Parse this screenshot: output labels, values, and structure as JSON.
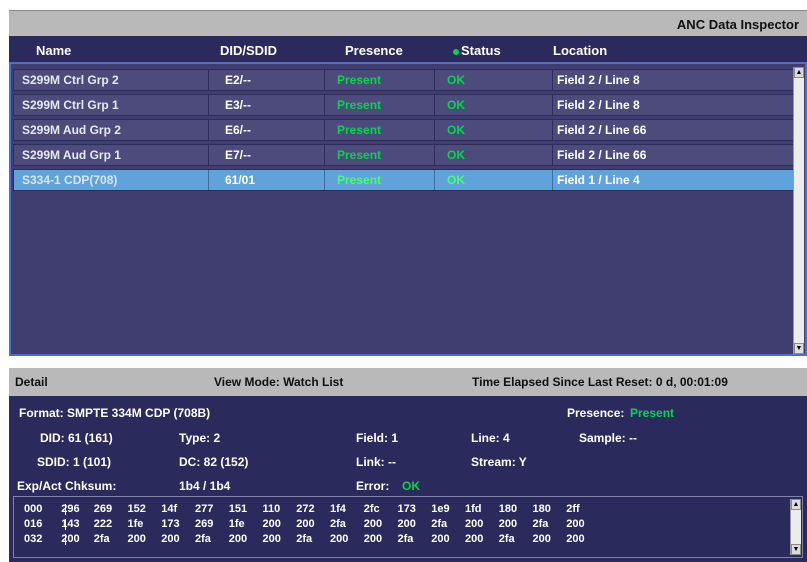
{
  "window": {
    "title": "ANC Data Inspector"
  },
  "columns": {
    "name": "Name",
    "did": "DID/SDID",
    "presence": "Presence",
    "status": "Status",
    "location": "Location"
  },
  "rows": [
    {
      "name": "S299M Ctrl Grp 2",
      "did": "E2/--",
      "presence": "Present",
      "status": "OK",
      "location": "Field 2 / Line 8",
      "selected": false
    },
    {
      "name": "S299M Ctrl Grp 1",
      "did": "E3/--",
      "presence": "Present",
      "status": "OK",
      "location": "Field 2 / Line 8",
      "selected": false
    },
    {
      "name": "S299M Aud Grp 2",
      "did": "E6/--",
      "presence": "Present",
      "status": "OK",
      "location": "Field 2 / Line 66",
      "selected": false
    },
    {
      "name": "S299M Aud Grp 1",
      "did": "E7/--",
      "presence": "Present",
      "status": "OK",
      "location": "Field 2 / Line 66",
      "selected": false
    },
    {
      "name": "S334-1 CDP(708)",
      "did": "61/01",
      "presence": "Present",
      "status": "OK",
      "location": "Field 1 / Line 4",
      "selected": true
    }
  ],
  "detail_header": {
    "title": "Detail",
    "view_mode": "View Mode: Watch List",
    "elapsed": "Time Elapsed Since Last Reset: 0 d, 00:01:09"
  },
  "detail": {
    "format": "Format:  SMPTE 334M CDP (708B)",
    "presence_label": "Presence:",
    "presence_value": "Present",
    "did": "DID: 61 (161)",
    "type": "Type: 2",
    "field": "Field:  1",
    "line": "Line:  4",
    "sample": "Sample:  --",
    "sdid": "SDID: 1 (101)",
    "dc": "DC:  82 (152)",
    "link": "Link:   --",
    "stream": "Stream:  Y",
    "chksum_label": "Exp/Act Chksum:",
    "chksum_value": "1b4 / 1b4",
    "error_label": "Error:",
    "error_value": "OK"
  },
  "hex": {
    "rows": [
      {
        "offset": "000",
        "bytes": [
          "296",
          "269",
          "152",
          "14f",
          "277",
          "151",
          "110",
          "272",
          "1f4",
          "2fc",
          "173",
          "1e9",
          "1fd",
          "180",
          "180",
          "2ff"
        ]
      },
      {
        "offset": "016",
        "bytes": [
          "143",
          "222",
          "1fe",
          "173",
          "269",
          "1fe",
          "200",
          "200",
          "2fa",
          "200",
          "200",
          "2fa",
          "200",
          "200",
          "2fa",
          "200"
        ]
      },
      {
        "offset": "032",
        "bytes": [
          "200",
          "2fa",
          "200",
          "200",
          "2fa",
          "200",
          "200",
          "2fa",
          "200",
          "200",
          "2fa",
          "200",
          "200",
          "2fa",
          "200",
          "200"
        ]
      }
    ]
  },
  "colors": {
    "panel": "#2b2a5c",
    "list_bg": "#403d70",
    "selected_row": "#5fa3da",
    "ok_green": "#00d84a",
    "header_gray": "#b9b9b9"
  },
  "icons": {
    "status_dot": "green-dot-icon",
    "scroll_up": "arrow-up-icon",
    "scroll_down": "arrow-down-icon"
  }
}
